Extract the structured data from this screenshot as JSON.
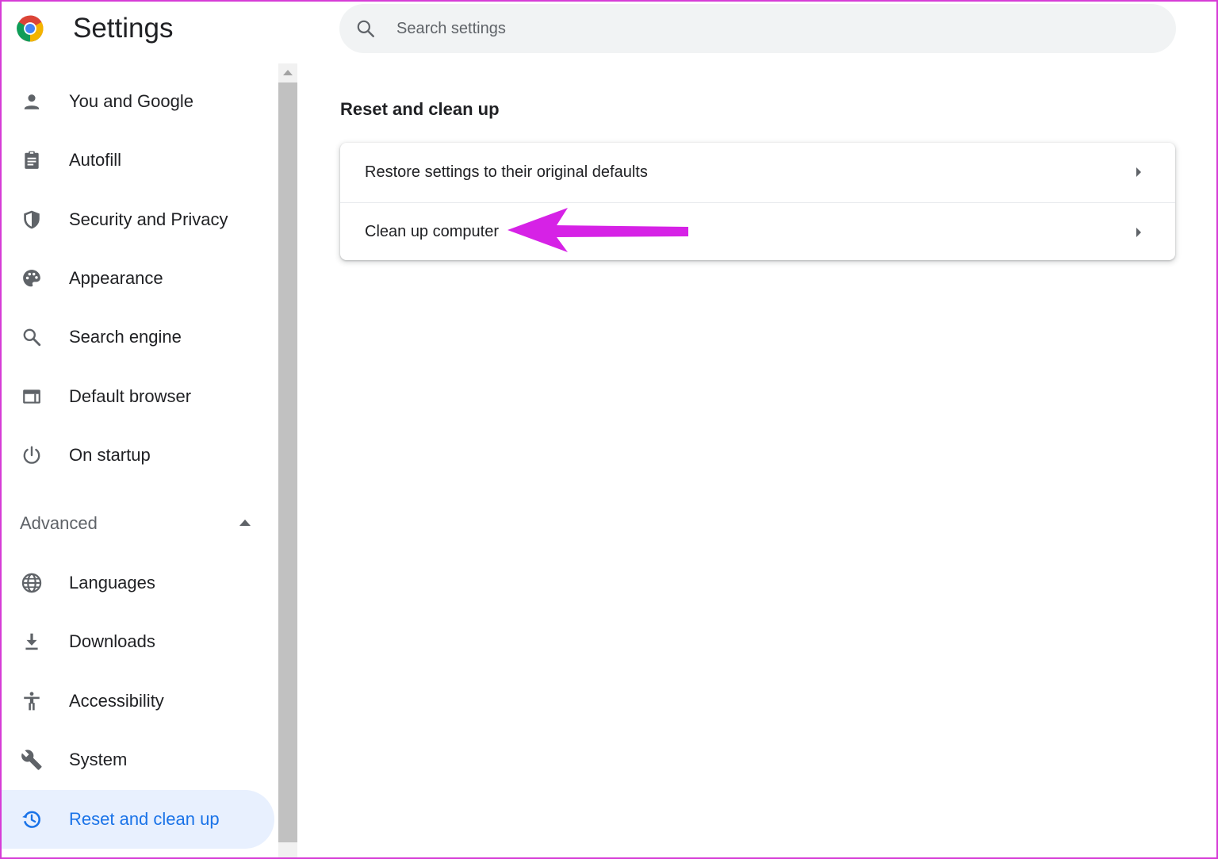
{
  "header": {
    "title": "Settings",
    "logo_icon": "chrome-logo"
  },
  "search": {
    "placeholder": "Search settings",
    "value": "",
    "icon": "search-icon"
  },
  "sidebar": {
    "items": [
      {
        "label": "You and Google",
        "icon": "person-icon"
      },
      {
        "label": "Autofill",
        "icon": "clipboard-icon"
      },
      {
        "label": "Security and Privacy",
        "icon": "shield-icon"
      },
      {
        "label": "Appearance",
        "icon": "palette-icon"
      },
      {
        "label": "Search engine",
        "icon": "search-icon"
      },
      {
        "label": "Default browser",
        "icon": "browser-window-icon"
      },
      {
        "label": "On startup",
        "icon": "power-icon"
      }
    ],
    "advanced_label": "Advanced",
    "advanced_items": [
      {
        "label": "Languages",
        "icon": "globe-icon"
      },
      {
        "label": "Downloads",
        "icon": "download-icon"
      },
      {
        "label": "Accessibility",
        "icon": "accessibility-icon"
      },
      {
        "label": "System",
        "icon": "wrench-icon"
      },
      {
        "label": "Reset and clean up",
        "icon": "restore-icon",
        "active": true
      }
    ]
  },
  "main": {
    "section_title": "Reset and clean up",
    "rows": [
      {
        "label": "Restore settings to their original defaults"
      },
      {
        "label": "Clean up computer"
      }
    ]
  },
  "colors": {
    "accent": "#1a73e8",
    "active_bg": "#e8f0fe",
    "annotation_arrow": "#d622e6",
    "frame_border": "#d63cd6"
  }
}
